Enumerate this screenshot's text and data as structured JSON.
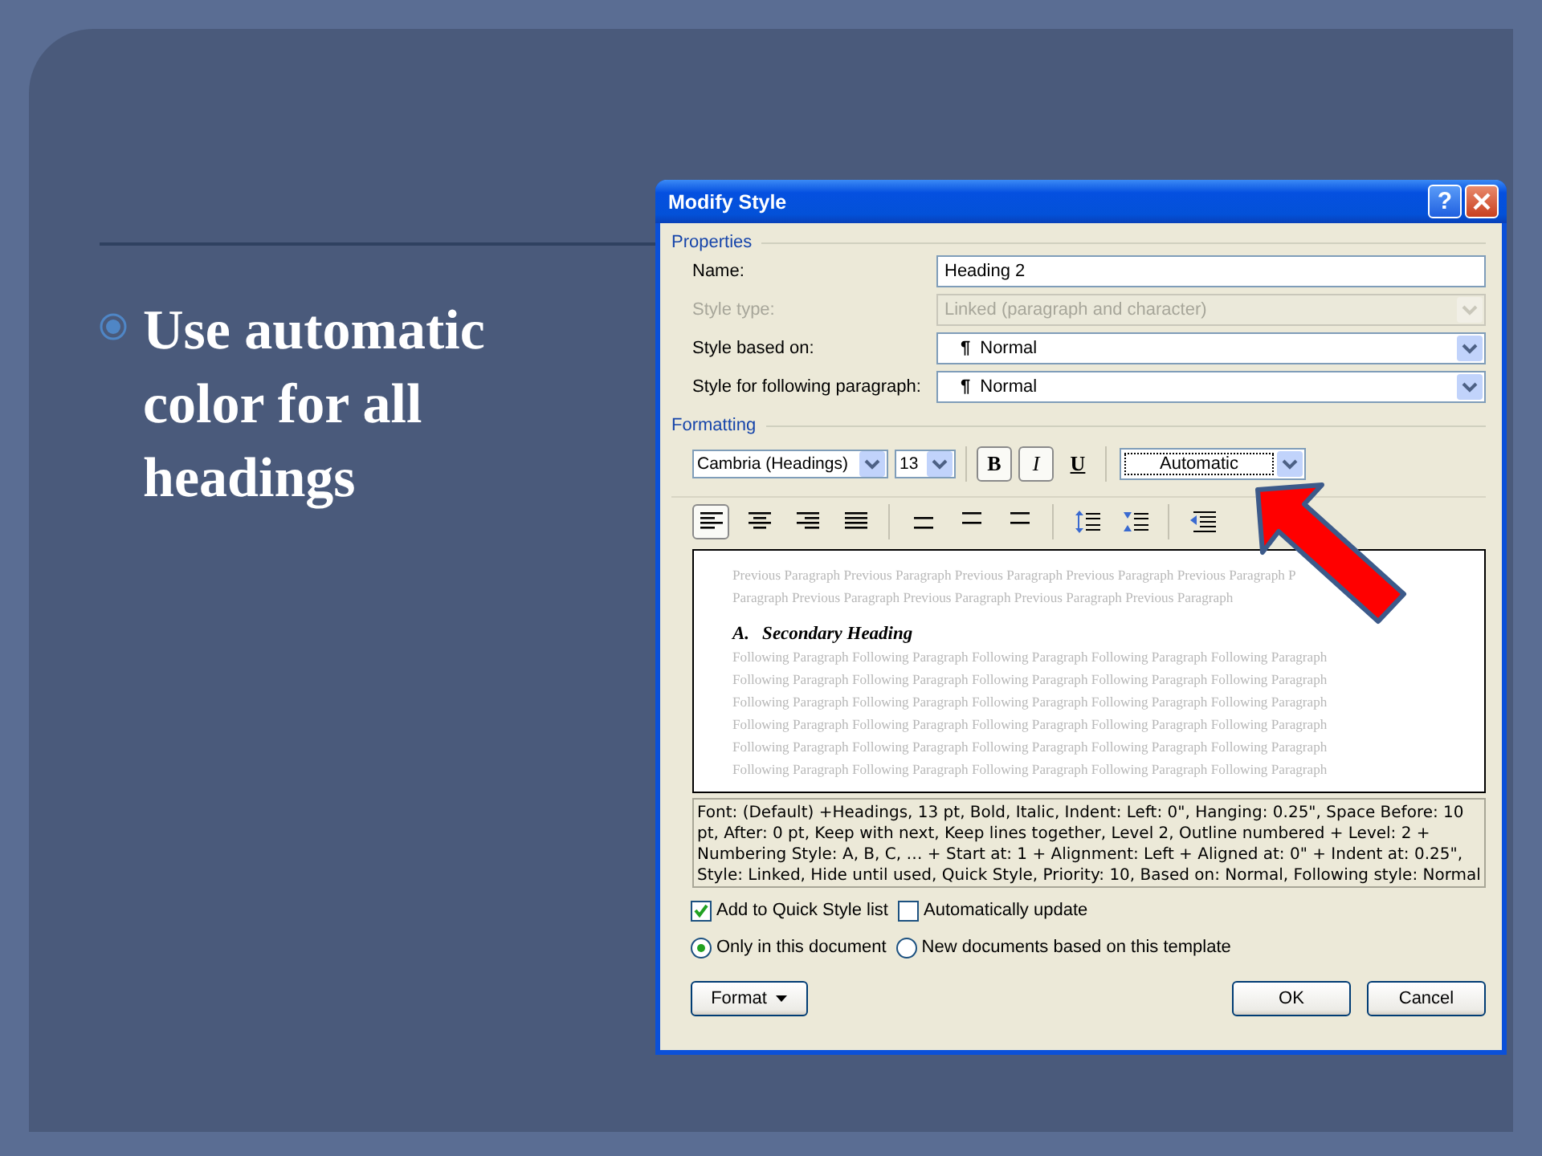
{
  "slide": {
    "bullet_text": "Use automatic color for all headings"
  },
  "dialog": {
    "title": "Modify Style",
    "help_button": "?",
    "properties": {
      "heading": "Properties",
      "fields": [
        {
          "label": "Name:",
          "value": "Heading 2",
          "kind": "text",
          "disabled": false
        },
        {
          "label": "Style type:",
          "value": "Linked (paragraph and character)",
          "kind": "dropdown",
          "disabled": true
        },
        {
          "label": "Style based on:",
          "value": "Normal",
          "pilcrow": "¶",
          "kind": "dropdown",
          "disabled": false
        },
        {
          "label": "Style for following paragraph:",
          "value": "Normal",
          "pilcrow": "¶",
          "kind": "dropdown",
          "disabled": false
        }
      ]
    },
    "formatting": {
      "heading": "Formatting",
      "font": "Cambria (Headings)",
      "size": "13",
      "styles": [
        {
          "label": "B",
          "kind": "bold",
          "selected": true
        },
        {
          "label": "I",
          "kind": "italic",
          "selected": true
        },
        {
          "label": "U",
          "kind": "underline",
          "selected": false
        }
      ],
      "color_name": "Automatic",
      "alignment": [
        {
          "selected": true
        },
        {
          "selected": false
        },
        {
          "selected": false
        },
        {
          "selected": false
        }
      ]
    },
    "preview": {
      "previous": [
        "Previous Paragraph Previous Paragraph Previous Paragraph Previous Paragraph Previous Paragraph P",
        "Paragraph Previous Paragraph Previous Paragraph Previous Paragraph Previous Paragraph"
      ],
      "heading_number": "A.",
      "heading": "Secondary Heading",
      "following": [
        "Following Paragraph Following Paragraph Following Paragraph Following Paragraph Following Paragraph",
        "Following Paragraph Following Paragraph Following Paragraph Following Paragraph Following Paragraph",
        "Following Paragraph Following Paragraph Following Paragraph Following Paragraph Following Paragraph",
        "Following Paragraph Following Paragraph Following Paragraph Following Paragraph Following Paragraph",
        "Following Paragraph Following Paragraph Following Paragraph Following Paragraph Following Paragraph",
        "Following Paragraph Following Paragraph Following Paragraph Following Paragraph Following Paragraph"
      ]
    },
    "description": "Font: (Default) +Headings, 13 pt, Bold, Italic, Indent: Left:  0\", Hanging:  0.25\", Space Before:  10 pt, After:  0 pt, Keep with next, Keep lines together, Level 2, Outline numbered + Level: 2 + Numbering Style: A, B, C, … + Start at: 1 + Alignment: Left + Aligned at:  0\" + Indent at:  0.25\", Style: Linked, Hide until used, Quick Style, Priority: 10, Based on: Normal, Following style: Normal",
    "checkboxes": [
      {
        "label": "Add to Quick Style list",
        "checked": true
      },
      {
        "label": "Automatically update",
        "checked": false
      }
    ],
    "radios": [
      {
        "label": "Only in this document",
        "selected": true
      },
      {
        "label": "New documents based on this template",
        "selected": false
      }
    ],
    "format_button": "Format",
    "ok_button": "OK",
    "cancel_button": "Cancel"
  }
}
